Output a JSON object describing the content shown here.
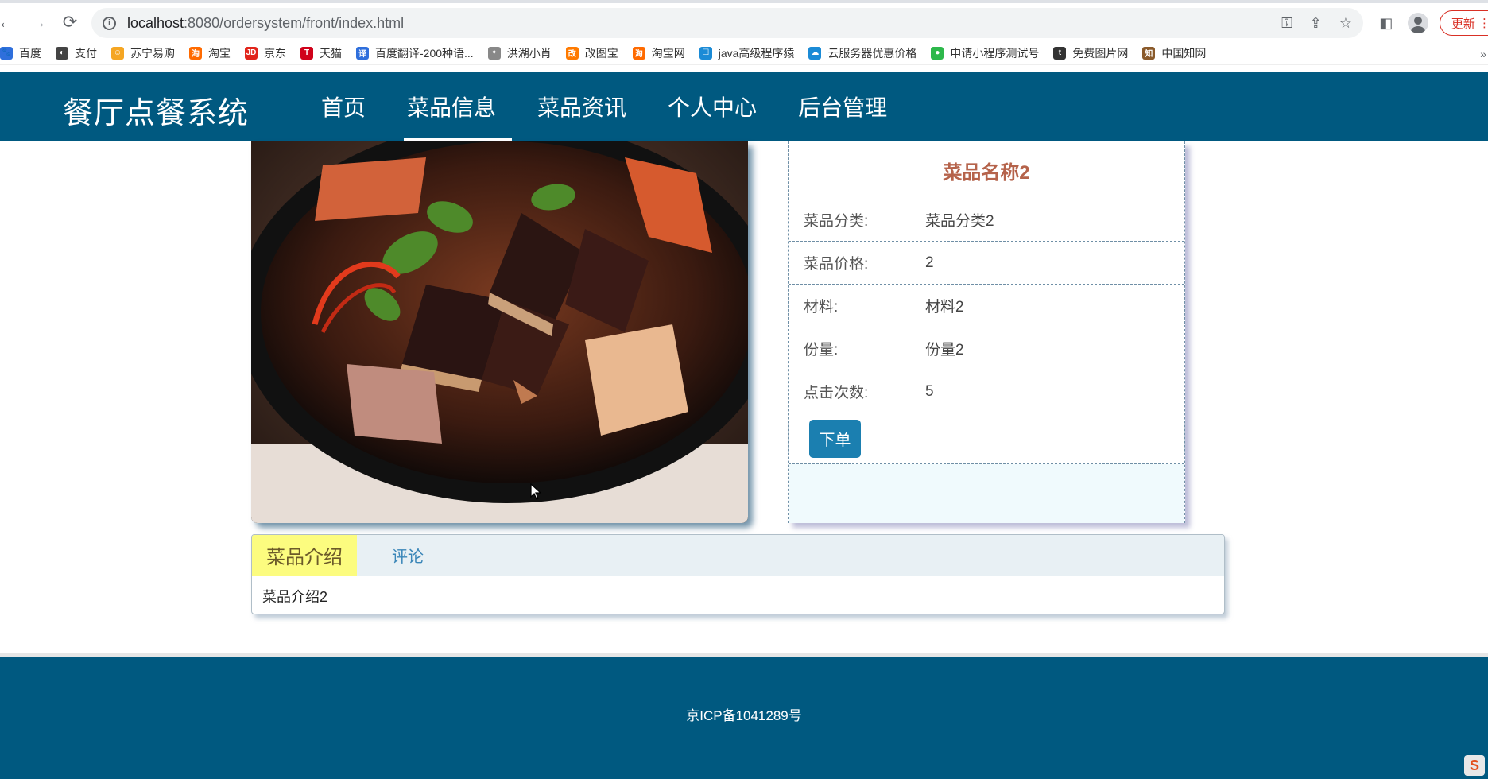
{
  "browser": {
    "url_host": "localhost",
    "url_rest": ":8080/ordersystem/front/index.html",
    "update_label": "更新",
    "bookmarks": [
      {
        "label": "百度",
        "color": "#2f6fdc",
        "glyph": "🐾"
      },
      {
        "label": "支付",
        "color": "#444444",
        "glyph": "◐"
      },
      {
        "label": "苏宁易购",
        "color": "#f5a623",
        "glyph": "☺"
      },
      {
        "label": "淘宝",
        "color": "#ff6a00",
        "glyph": "淘"
      },
      {
        "label": "京东",
        "color": "#e1251b",
        "glyph": "JD"
      },
      {
        "label": "天猫",
        "color": "#d0021b",
        "glyph": "T"
      },
      {
        "label": "百度翻译-200种语...",
        "color": "#2f6fdc",
        "glyph": "译"
      },
      {
        "label": "洪湖小肖",
        "color": "#888888",
        "glyph": "✦"
      },
      {
        "label": "改图宝",
        "color": "#ff7a00",
        "glyph": "改"
      },
      {
        "label": "淘宝网",
        "color": "#ff6a00",
        "glyph": "淘"
      },
      {
        "label": "java高级程序猿",
        "color": "#1b8bd6",
        "glyph": "☐"
      },
      {
        "label": "云服务器优惠价格",
        "color": "#1b8bd6",
        "glyph": "☁"
      },
      {
        "label": "申请小程序测试号",
        "color": "#2db84b",
        "glyph": "●"
      },
      {
        "label": "免费图片网",
        "color": "#333333",
        "glyph": "t"
      },
      {
        "label": "中国知网",
        "color": "#8a5a2b",
        "glyph": "知"
      }
    ]
  },
  "site": {
    "title": "餐厅点餐系统",
    "nav": [
      {
        "label": "首页",
        "active": false
      },
      {
        "label": "菜品信息",
        "active": true
      },
      {
        "label": "菜品资讯",
        "active": false
      },
      {
        "label": "个人中心",
        "active": false
      },
      {
        "label": "后台管理",
        "active": false
      }
    ]
  },
  "product": {
    "name": "菜品名称2",
    "fields": [
      {
        "label": "菜品分类:",
        "value": "菜品分类2"
      },
      {
        "label": "菜品价格:",
        "value": "2"
      },
      {
        "label": "材料:",
        "value": "材料2"
      },
      {
        "label": "份量:",
        "value": "份量2"
      },
      {
        "label": "点击次数:",
        "value": "5"
      }
    ],
    "order_label": "下单"
  },
  "tabs": {
    "items": [
      {
        "label": "菜品介绍",
        "active": true
      },
      {
        "label": "评论",
        "active": false
      }
    ],
    "content": "菜品介绍2"
  },
  "footer": {
    "icp": "京ICP备1041289号"
  }
}
